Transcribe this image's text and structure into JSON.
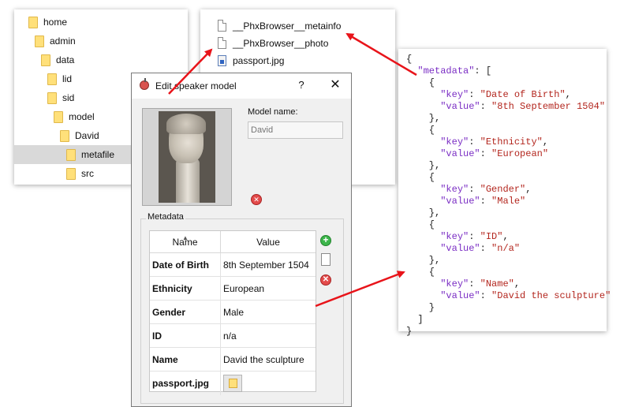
{
  "tree": {
    "items": [
      {
        "label": "home"
      },
      {
        "label": "admin"
      },
      {
        "label": "data"
      },
      {
        "label": "lid"
      },
      {
        "label": "sid"
      },
      {
        "label": "model"
      },
      {
        "label": "David"
      },
      {
        "label": "metafile",
        "selected": true
      },
      {
        "label": "src"
      }
    ]
  },
  "files": {
    "items": [
      {
        "label": "__PhxBrowser__metainfo",
        "icon": "document-icon"
      },
      {
        "label": "__PhxBrowser__photo",
        "icon": "document-icon"
      },
      {
        "label": "passport.jpg",
        "icon": "image-file-icon"
      }
    ]
  },
  "dialog": {
    "title": "Edit speaker model",
    "help": "?",
    "close": "✕",
    "model_name_label": "Model name:",
    "model_name_placeholder": "David",
    "metadata_title": "Metadata",
    "table": {
      "headers": {
        "name": "Name",
        "value": "Value"
      },
      "rows": [
        {
          "key": "Date of Birth",
          "value": "8th September 1504"
        },
        {
          "key": "Ethnicity",
          "value": "European"
        },
        {
          "key": "Gender",
          "value": "Male"
        },
        {
          "key": "ID",
          "value": "n/a"
        },
        {
          "key": "Name",
          "value": "David the sculpture"
        },
        {
          "key": "passport.jpg",
          "value": ""
        }
      ]
    }
  },
  "json_panel": {
    "lines": [
      "{",
      "  \"metadata\": [",
      "    {",
      "      \"key\": \"Date of Birth\",",
      "      \"value\": \"8th September 1504\"",
      "    },",
      "    {",
      "      \"key\": \"Ethnicity\",",
      "      \"value\": \"European\"",
      "    },",
      "    {",
      "      \"key\": \"Gender\",",
      "      \"value\": \"Male\"",
      "    },",
      "    {",
      "      \"key\": \"ID\",",
      "      \"value\": \"n/a\"",
      "    },",
      "    {",
      "      \"key\": \"Name\",",
      "      \"value\": \"David the sculpture\"",
      "    }",
      "  ]",
      "}"
    ]
  },
  "colors": {
    "arrow": "#e8141a",
    "json_key": "#7a2dc4",
    "json_string": "#b3261e",
    "folder": "#ffe07a",
    "selection": "#d9d9d9"
  }
}
